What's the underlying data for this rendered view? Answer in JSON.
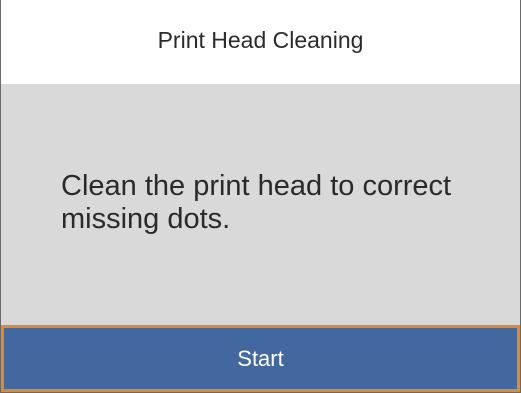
{
  "header": {
    "title": "Print Head Cleaning"
  },
  "main": {
    "message": "Clean the print head to correct missing dots."
  },
  "footer": {
    "start_label": "Start"
  },
  "colors": {
    "content_background": "#d9d9d9",
    "button_background": "#43679f",
    "selection_outline": "#e18a2a"
  }
}
